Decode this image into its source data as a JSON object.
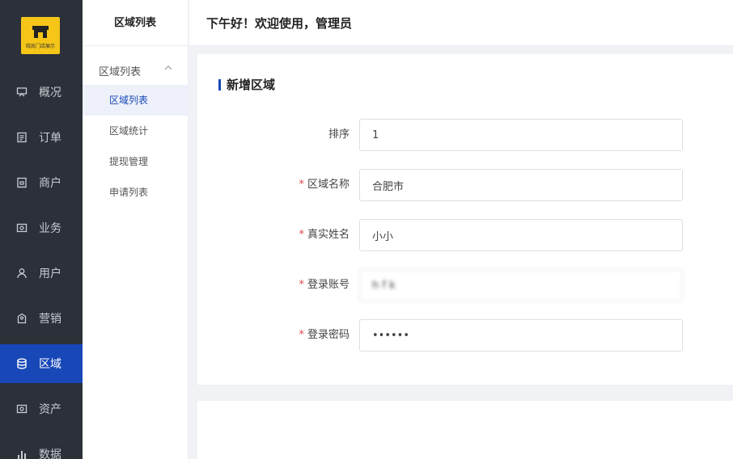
{
  "logo": {
    "text": "晓凯门店展示",
    "icon": "shop-icon",
    "color": "#f5c518"
  },
  "nav": {
    "items": [
      {
        "label": "概况",
        "icon": "presentation-icon"
      },
      {
        "label": "订单",
        "icon": "document-icon"
      },
      {
        "label": "商户",
        "icon": "store-icon"
      },
      {
        "label": "业务",
        "icon": "wallet-icon"
      },
      {
        "label": "用户",
        "icon": "user-icon"
      },
      {
        "label": "营销",
        "icon": "tag-icon"
      },
      {
        "label": "区域",
        "icon": "database-icon",
        "active": true
      },
      {
        "label": "资产",
        "icon": "asset-icon"
      },
      {
        "label": "数据",
        "icon": "bar-chart-icon"
      }
    ],
    "active_color": "#1848b8"
  },
  "subnav": {
    "title": "区域列表",
    "group": "区域列表",
    "items": [
      {
        "label": "区域列表",
        "active": true
      },
      {
        "label": "区域统计"
      },
      {
        "label": "提现管理"
      },
      {
        "label": "申请列表"
      }
    ]
  },
  "header": {
    "greeting": "下午好！欢迎使用，管理员"
  },
  "form": {
    "title": "新增区域",
    "fields": [
      {
        "label": "排序",
        "required": false,
        "value": "1"
      },
      {
        "label": "区域名称",
        "required": true,
        "value": "合肥市"
      },
      {
        "label": "真实姓名",
        "required": true,
        "value": "小小"
      },
      {
        "label": "登录账号",
        "required": true,
        "value": "h f k"
      },
      {
        "label": "登录密码",
        "required": true,
        "value": "••••••"
      }
    ]
  }
}
